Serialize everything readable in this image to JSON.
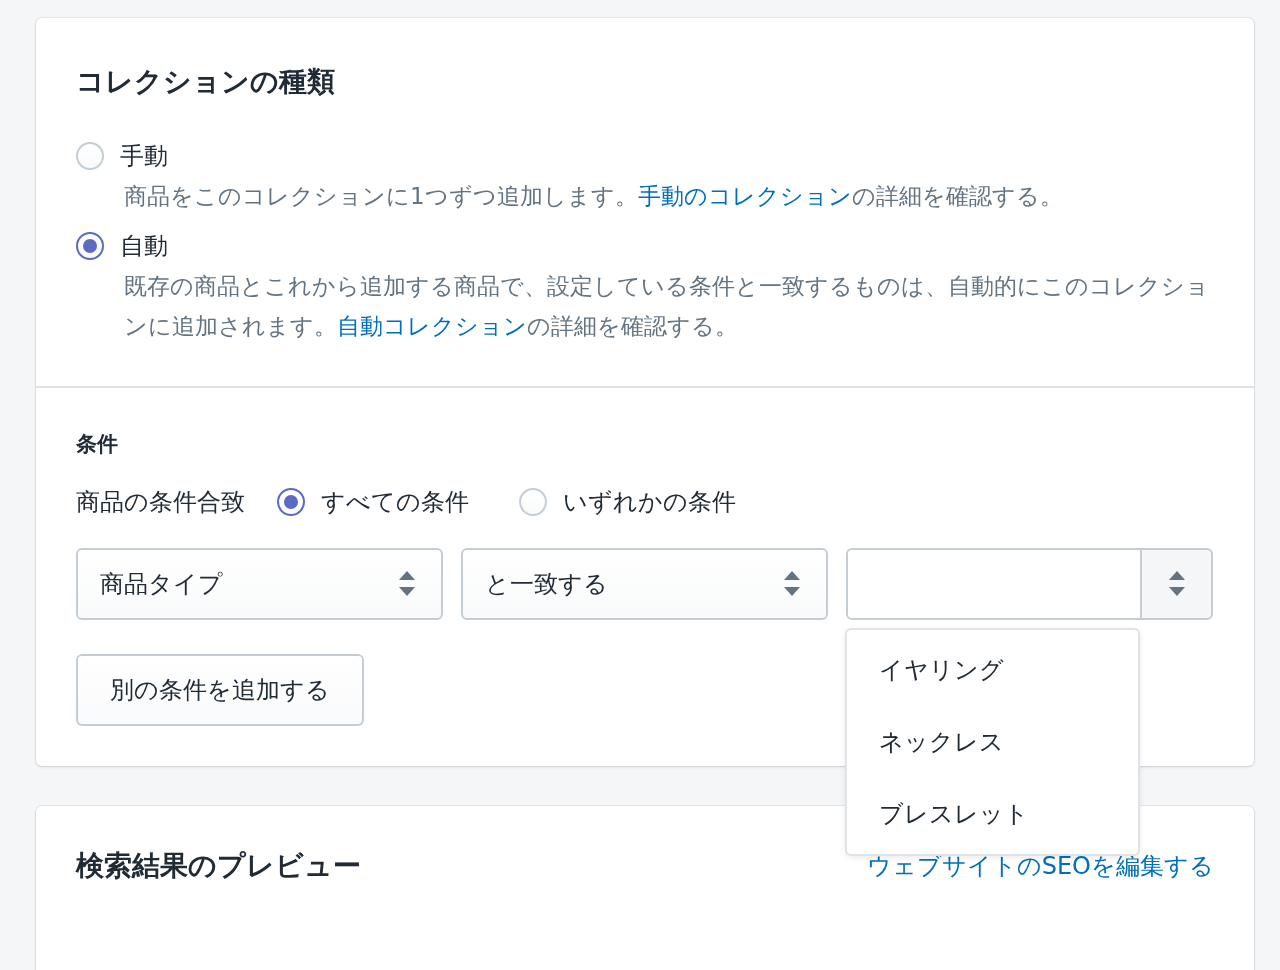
{
  "collection_type": {
    "title": "コレクションの種類",
    "options": [
      {
        "label": "手動",
        "selected": false,
        "description": "商品をこのコレクションに1つずつ追加します。",
        "link": "手動のコレクション",
        "description_end": "の詳細を確認する。"
      },
      {
        "label": "自動",
        "selected": true,
        "description": "既存の商品とこれから追加する商品で、設定している条件と一致するものは、自動的にこのコレクションに追加されます。",
        "link": "自動コレクション",
        "description_end": "の詳細を確認する。"
      }
    ]
  },
  "conditions": {
    "title": "条件",
    "match_label": "商品の条件合致",
    "match_options": [
      {
        "label": "すべての条件",
        "selected": true
      },
      {
        "label": "いずれかの条件",
        "selected": false
      }
    ],
    "rule": {
      "column": "商品タイプ",
      "relation": "と一致する",
      "value_options": [
        {
          "label": "イヤリング"
        },
        {
          "label": "ネックレス"
        },
        {
          "label": "ブレスレット"
        }
      ]
    },
    "add_button": "別の条件を追加する"
  },
  "preview": {
    "title": "検索結果のプレビュー",
    "link": "ウェブサイトのSEOを編集する"
  }
}
